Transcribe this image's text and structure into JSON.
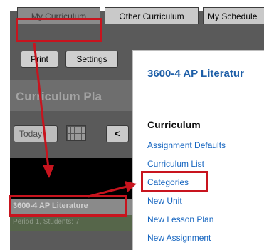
{
  "nav": {
    "tabs": [
      {
        "label": "My Curriculum"
      },
      {
        "label": "Other Curriculum"
      },
      {
        "label": "My Schedule"
      }
    ]
  },
  "toolbar": {
    "print_label": "Print",
    "settings_label": "Settings"
  },
  "planner": {
    "title": "Curriculum Pla",
    "today_label": "Today",
    "prev_label": "<",
    "course_title": "3600-4 AP Literature",
    "course_subtitle": "Period 1, Students: 7"
  },
  "popup": {
    "title": "3600-4 AP Literatur",
    "section_heading": "Curriculum",
    "items": [
      {
        "label": "Assignment Defaults"
      },
      {
        "label": "Curriculum List"
      },
      {
        "label": "Categories"
      },
      {
        "label": "New Unit"
      },
      {
        "label": "New Lesson Plan"
      },
      {
        "label": "New Assignment"
      }
    ]
  },
  "annotation": {
    "highlight_color": "#c8141e"
  }
}
